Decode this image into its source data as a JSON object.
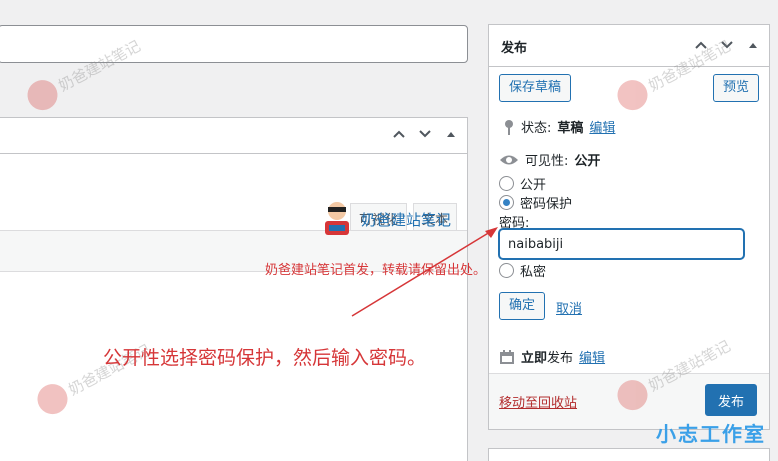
{
  "publish": {
    "title": "发布",
    "save_draft": "保存草稿",
    "preview": "预览",
    "status_label": "状态:",
    "status_value": "草稿",
    "status_edit": "编辑",
    "visibility_label": "可见性:",
    "visibility_value": "公开",
    "options": [
      "公开",
      "密码保护",
      "私密"
    ],
    "selected_option": "密码保护",
    "password_label": "密码:",
    "password_value": "naibabiji",
    "ok": "确定",
    "cancel": "取消",
    "publish_time_label": "立即",
    "publish_time_suffix": "发布",
    "publish_time_edit": "编辑",
    "trash": "移动至回收站",
    "publish_button": "发布"
  },
  "editor": {
    "tab_visual": "可视化",
    "tab_text": "文本"
  },
  "overlays": {
    "watermark": "奶爸建站笔记",
    "logo_text": "奶爸建站笔记",
    "notice": "奶爸建站笔记首发，转载请保留出处。",
    "annotation": "公开性选择密码保护，然后输入密码。",
    "brand": "小志工作室"
  },
  "colors": {
    "accent": "#2271b1",
    "annotation": "#d63638",
    "trash": "#b32d2e"
  }
}
